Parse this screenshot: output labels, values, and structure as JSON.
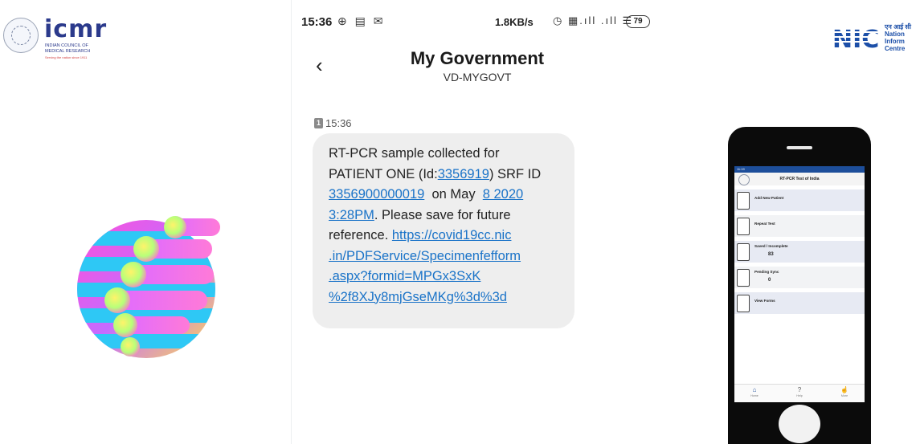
{
  "icmr": {
    "wordmark": "icmr",
    "line1": "INDIAN COUNCIL OF",
    "line2": "MEDICAL RESEARCH",
    "tagline": "Serving the nation since 1911"
  },
  "sms": {
    "status_time": "15:36",
    "status_icons_left": "⊕ ▤ ✉",
    "status_speed": "1.8KB/s",
    "status_icons_right": "◷ ▦.ıll .ıll ☰",
    "battery": "79",
    "back_icon": "‹",
    "sender_name": "My Government",
    "sender_id": "VD-MYGOVT",
    "sim_badge": "1",
    "message_time": "15:36",
    "message": {
      "l1": "RT-PCR sample collected for",
      "l2_pre": "PATIENT ONE (Id:",
      "l2_link": "3356919",
      "l2_post": ") SRF ID",
      "l3_link": "3356900000019",
      "l3_mid": "  on May  ",
      "l3_link2": "8 2020",
      "l4_link": "3:28PM",
      "l4_post": ". Please save for future",
      "l5_pre": "reference. ",
      "l5_link": "https://covid19cc.nic",
      "l6_link": ".in/PDFService/Specimenfefform",
      "l7_link": ".aspx?formid=MPGx3SxK",
      "l8_link": "%2f8XJy8mjGseMKg%3d%3d"
    }
  },
  "nic": {
    "logo_text": "NIC",
    "hindi": "एन आई सी",
    "line1": "Nation",
    "line2": "Inform",
    "line3": "Centre"
  },
  "app": {
    "status": "11:19",
    "title": "RT-PCR Test of India",
    "menu": [
      {
        "label": "Add New Patient"
      },
      {
        "label": "Repeat Test"
      },
      {
        "label": "Saved / Incomplete",
        "count": "83"
      },
      {
        "label": "Pending Sync",
        "count": "0"
      },
      {
        "label": "View Forms"
      }
    ],
    "nav": [
      {
        "icon": "⌂",
        "label": "Home"
      },
      {
        "icon": "?",
        "label": "Help"
      },
      {
        "icon": "☝",
        "label": "More"
      }
    ]
  },
  "colors": {
    "link": "#1a73c8",
    "bubble": "#eeeeee",
    "app_bar": "#1d4e9a",
    "icmr_blue": "#2b3a8c",
    "nic_blue": "#1c4fa8"
  }
}
